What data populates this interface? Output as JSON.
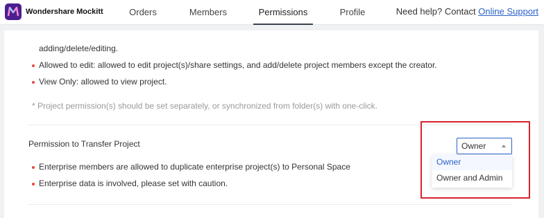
{
  "brand": {
    "name": "Wondershare Mockitt"
  },
  "nav": {
    "tabs": [
      {
        "label": "Orders"
      },
      {
        "label": "Members"
      },
      {
        "label": "Permissions"
      },
      {
        "label": "Profile"
      }
    ],
    "active_tab": "Permissions"
  },
  "help": {
    "text": "Need help? Contact",
    "link": "Online Support"
  },
  "permissions_info": {
    "continued_text": "adding/delete/editing.",
    "items": [
      "Allowed to edit: allowed to edit project(s)/share settings, and add/delete project members except the creator.",
      "View Only: allowed to view project."
    ],
    "note": "* Project permission(s) should be set separately, or synchronized from folder(s) with one-click."
  },
  "transfer_section": {
    "title": "Permission to Transfer Project",
    "items": [
      "Enterprise members are allowed to duplicate enterprise project(s) to Personal Space",
      "Enterprise data is involved, please set with caution."
    ],
    "select": {
      "value": "Owner",
      "options": [
        "Owner",
        "Owner and Admin"
      ]
    }
  },
  "colors": {
    "accent": "#2a62c9",
    "bullet": "#e34a3a",
    "highlight_border": "#d5232e",
    "logo_bg": "#4b1f8f"
  },
  "icons": [
    "mockitt-logo-icon",
    "caret-up-icon",
    "bullet-dot-icon"
  ]
}
